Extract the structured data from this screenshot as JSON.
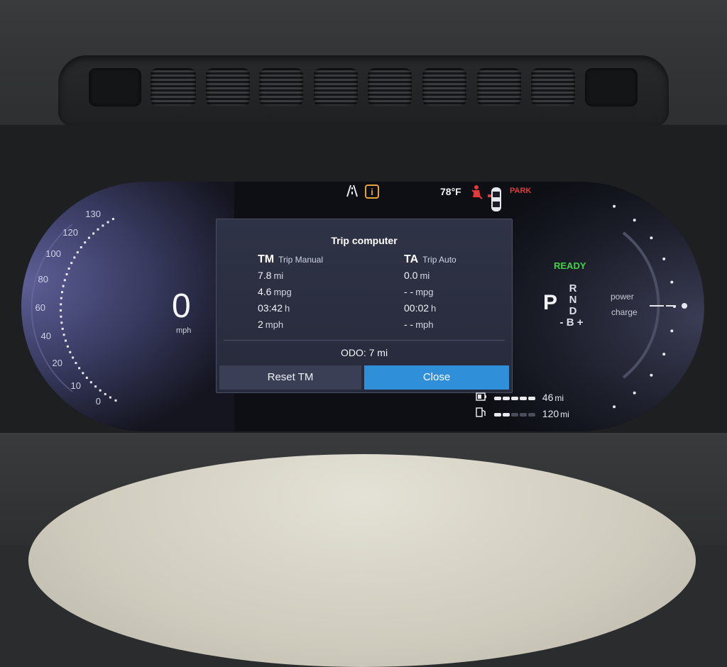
{
  "status": {
    "temperature": "78°F",
    "park_label": "PARK"
  },
  "speedometer": {
    "speed": "0",
    "unit": "mph",
    "scale": [
      "130",
      "120",
      "100",
      "80",
      "60",
      "40",
      "20",
      "10",
      "0"
    ]
  },
  "trip_computer": {
    "title": "Trip computer",
    "manual": {
      "code": "TM",
      "name": "Trip Manual",
      "distance": "7.8",
      "distance_unit": "mi",
      "consumption": "4.6",
      "consumption_unit": "mpg",
      "time": "03:42",
      "time_unit": "h",
      "avg_speed": "2",
      "avg_speed_unit": "mph"
    },
    "auto": {
      "code": "TA",
      "name": "Trip Auto",
      "distance": "0.0",
      "distance_unit": "mi",
      "consumption": "- -",
      "consumption_unit": "mpg",
      "time": "00:02",
      "time_unit": "h",
      "avg_speed": "- -",
      "avg_speed_unit": "mph"
    },
    "odo": "ODO:  7 mi",
    "reset_label": "Reset TM",
    "close_label": "Close"
  },
  "drive": {
    "ready": "READY",
    "gear_selected": "P",
    "gears": [
      "R",
      "N",
      "D",
      "- B +"
    ],
    "power_label": "power",
    "charge_label": "charge"
  },
  "range": {
    "battery_range": "46",
    "battery_unit": "mi",
    "fuel_range": "120",
    "fuel_unit": "mi"
  },
  "colors": {
    "ready": "#41d246",
    "warning": "#e8a23a",
    "alert": "#e43a3a",
    "accent": "#2f8fd8"
  }
}
